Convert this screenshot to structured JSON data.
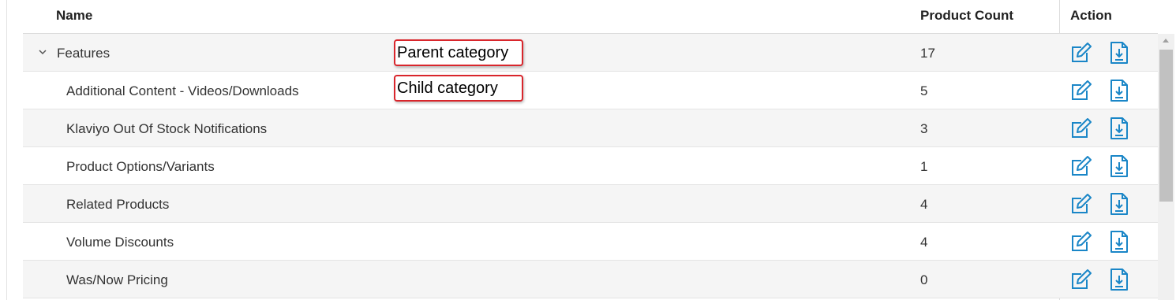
{
  "table": {
    "columns": {
      "name": "Name",
      "count": "Product Count",
      "action": "Action"
    },
    "rows": [
      {
        "name": "Features",
        "count": "17",
        "level": "parent",
        "expanded": true
      },
      {
        "name": "Additional Content - Videos/Downloads",
        "count": "5",
        "level": "child"
      },
      {
        "name": "Klaviyo Out Of Stock Notifications",
        "count": "3",
        "level": "child"
      },
      {
        "name": "Product Options/Variants",
        "count": "1",
        "level": "child"
      },
      {
        "name": "Related Products",
        "count": "4",
        "level": "child"
      },
      {
        "name": "Volume Discounts",
        "count": "4",
        "level": "child"
      },
      {
        "name": "Was/Now Pricing",
        "count": "0",
        "level": "child"
      }
    ]
  },
  "annotations": {
    "parent": "Parent category",
    "child": "Child category"
  },
  "icons": {
    "edit": "edit-icon",
    "download": "download-file-icon",
    "expand": "chevron-down-icon"
  },
  "colors": {
    "accent": "#1a86c7",
    "callout_border": "#d9262c",
    "row_alt": "#f5f5f5"
  }
}
